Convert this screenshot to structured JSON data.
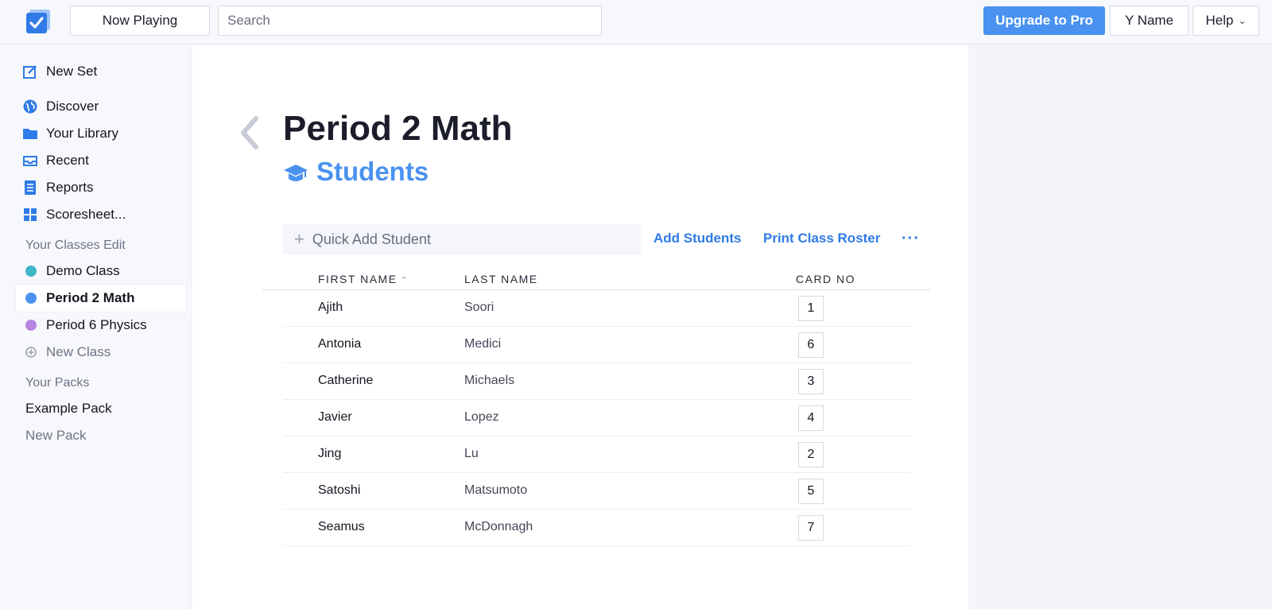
{
  "topbar": {
    "now_playing": "Now Playing",
    "search_placeholder": "Search",
    "upgrade": "Upgrade to Pro",
    "user": "Y Name",
    "help": "Help"
  },
  "sidebar": {
    "nav": [
      {
        "label": "New Set",
        "icon": "edit-icon"
      },
      {
        "label": "Discover",
        "icon": "globe-icon"
      },
      {
        "label": "Your Library",
        "icon": "folder-icon"
      },
      {
        "label": "Recent",
        "icon": "inbox-icon"
      },
      {
        "label": "Reports",
        "icon": "document-icon"
      },
      {
        "label": "Scoresheet...",
        "icon": "grid-icon"
      }
    ],
    "classes_label": "Your Classes Edit",
    "classes": [
      {
        "label": "Demo Class",
        "color": "#3fb7c7"
      },
      {
        "label": "Period 2 Math",
        "color": "#4a92f0"
      },
      {
        "label": "Period 6 Physics",
        "color": "#b884e0"
      }
    ],
    "new_class": "New Class",
    "packs_label": "Your Packs",
    "packs": [
      "Example Pack"
    ],
    "new_pack": "New Pack"
  },
  "main": {
    "title": "Period 2 Math",
    "subtitle": "Students",
    "quick_add_placeholder": "Quick Add Student",
    "add_students": "Add Students",
    "print_roster": "Print Class Roster",
    "more": "···",
    "columns": {
      "first": "FIRST NAME",
      "last": "LAST NAME",
      "card": "CARD NO"
    },
    "students": [
      {
        "first": "Ajith",
        "last": "Soori",
        "card": "1"
      },
      {
        "first": "Antonia",
        "last": "Medici",
        "card": "6"
      },
      {
        "first": "Catherine",
        "last": "Michaels",
        "card": "3"
      },
      {
        "first": "Javier",
        "last": "Lopez",
        "card": "4"
      },
      {
        "first": "Jing",
        "last": "Lu",
        "card": "2"
      },
      {
        "first": "Satoshi",
        "last": "Matsumoto",
        "card": "5"
      },
      {
        "first": "Seamus",
        "last": "McDonnagh",
        "card": "7"
      }
    ]
  },
  "colors": {
    "accent": "#4a92f0",
    "link": "#2f7be8"
  }
}
